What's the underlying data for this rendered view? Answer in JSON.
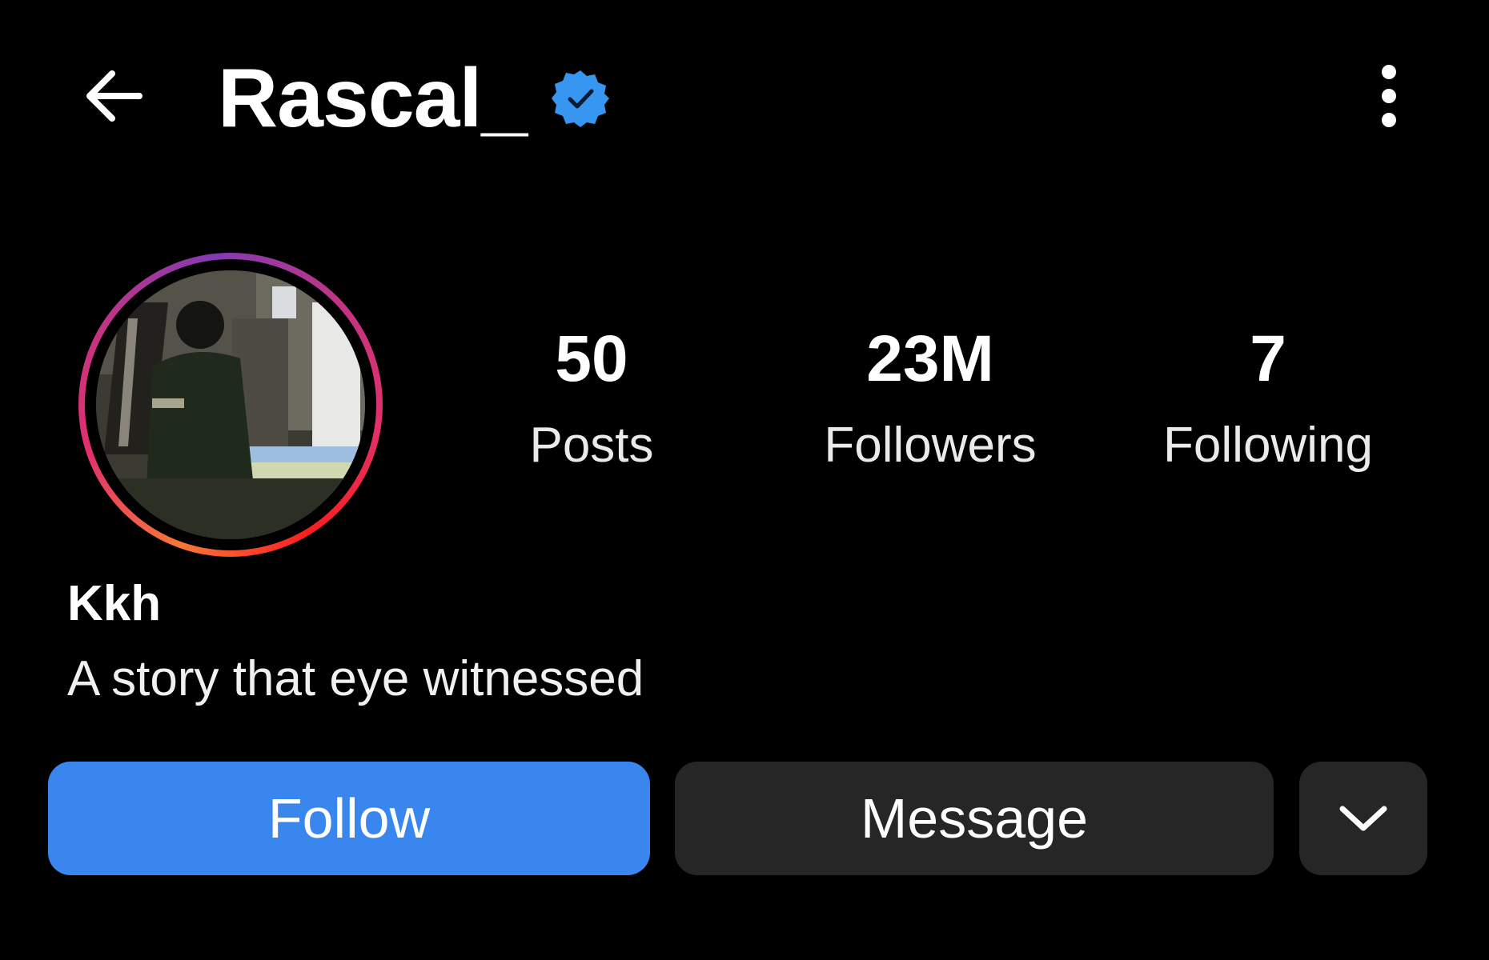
{
  "header": {
    "back_icon": "arrow-left-icon",
    "username": "Rascal_",
    "verified_icon": "verified-badge-icon",
    "more_icon": "more-vertical-icon"
  },
  "profile": {
    "avatar_icon": "profile-photo",
    "display_name": "Kkh",
    "bio": "A story that eye witnessed"
  },
  "stats": [
    {
      "value": "50",
      "label": "Posts"
    },
    {
      "value": "23M",
      "label": "Followers"
    },
    {
      "value": "7",
      "label": "Following"
    }
  ],
  "actions": {
    "follow_label": "Follow",
    "message_label": "Message",
    "dropdown_icon": "chevron-down-icon"
  },
  "colors": {
    "background": "#000000",
    "follow_button": "#3a86ef",
    "secondary_button": "#262626",
    "verified_blue": "#3797f0"
  }
}
